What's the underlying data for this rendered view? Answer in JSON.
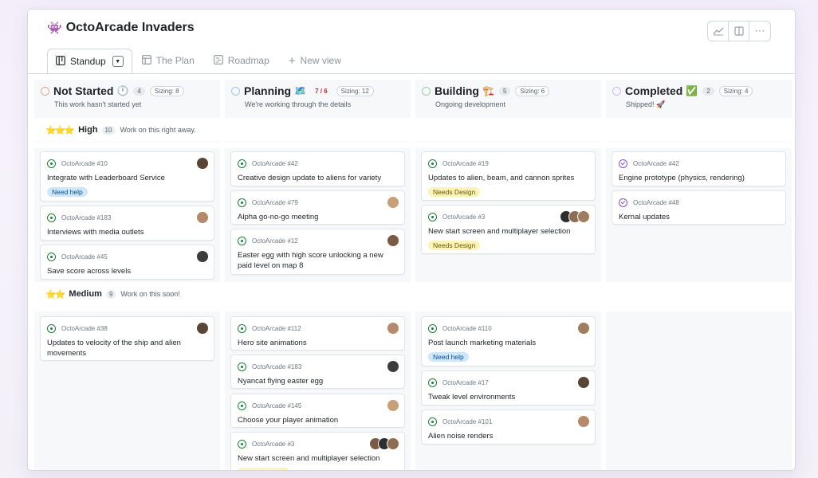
{
  "app": {
    "title": "OctoArcade Invaders",
    "title_icon": "space-invader-icon"
  },
  "top_actions": [
    "insights-icon",
    "panel-icon",
    "more-icon"
  ],
  "tabs": [
    {
      "label": "Standup",
      "active": true,
      "icon": "board-icon"
    },
    {
      "label": "The Plan",
      "active": false,
      "icon": "table-icon"
    },
    {
      "label": "Roadmap",
      "active": false,
      "icon": "roadmap-icon"
    },
    {
      "label": "New view",
      "active": false,
      "icon": "plus-icon"
    }
  ],
  "columns": [
    {
      "name": "Not Started",
      "emoji": "🕛",
      "count": "4",
      "sizing": "Sizing: 8",
      "desc": "This work hasn't started yet",
      "circle_color": "#f0a58a"
    },
    {
      "name": "Planning",
      "emoji": "🗺️",
      "count": "7 / 6",
      "sizing": "Sizing: 12",
      "desc": "We're working through the details",
      "circle_color": "#9cc7f0"
    },
    {
      "name": "Building",
      "emoji": "🏗️",
      "count": "5",
      "sizing": "Sizing: 6",
      "desc": "Ongoing development",
      "circle_color": "#92d4a0"
    },
    {
      "name": "Completed",
      "emoji": "✅",
      "count": "2",
      "sizing": "Sizing: 4",
      "desc": "Shipped! 🚀",
      "circle_color": "#d4b7f3"
    }
  ],
  "groups": [
    {
      "stars": "⭐⭐⭐",
      "name": "High",
      "count": "10",
      "desc": "Work on this right away."
    },
    {
      "stars": "⭐⭐",
      "name": "Medium",
      "count": "9",
      "desc": "Work on this soon!"
    }
  ],
  "cards": {
    "high": [
      [
        {
          "id": "OctoArcade #10",
          "title": "Integrate with Leaderboard Service",
          "label": "Need help",
          "label_type": "help"
        },
        {
          "id": "OctoArcade #183",
          "title": "Interviews with media outlets"
        },
        {
          "id": "OctoArcade #45",
          "title": "Save score across levels"
        }
      ],
      [
        {
          "id": "OctoArcade #42",
          "title": "Creative design update to aliens for variety"
        },
        {
          "id": "OctoArcade #79",
          "title": "Alpha go-no-go meeting"
        },
        {
          "id": "OctoArcade #12",
          "title": "Easter egg with high score unlocking a new paid level on map 8"
        }
      ],
      [
        {
          "id": "OctoArcade #19",
          "title": "Updates to alien, beam, and cannon sprites",
          "label": "Needs Design",
          "label_type": "design"
        },
        {
          "id": "OctoArcade #3",
          "title": "New start screen and multiplayer selection",
          "label": "Needs Design",
          "label_type": "design"
        }
      ],
      [
        {
          "id": "OctoArcade #42",
          "title": "Engine prototype (physics, rendering)"
        },
        {
          "id": "OctoArcade #48",
          "title": "Kernal updates"
        }
      ]
    ],
    "medium": [
      [
        {
          "id": "OctoArcade #38",
          "title": "Updates to velocity of the ship and alien movements"
        }
      ],
      [
        {
          "id": "OctoArcade #112",
          "title": "Hero site animations"
        },
        {
          "id": "OctoArcade #183",
          "title": "Nyancat flying easter egg"
        },
        {
          "id": "OctoArcade #145",
          "title": "Choose your player animation"
        },
        {
          "id": "OctoArcade #3",
          "title": "New start screen and multiplayer selection",
          "label": "Needs Design",
          "label_type": "design"
        }
      ],
      [
        {
          "id": "OctoArcade #110",
          "title": "Post launch marketing materials",
          "label": "Need help",
          "label_type": "help"
        },
        {
          "id": "OctoArcade #17",
          "title": "Tweak level environments"
        },
        {
          "id": "OctoArcade #101",
          "title": "Alien noise renders"
        }
      ],
      []
    ]
  },
  "colors": {
    "open_issue": "#1a7f37",
    "closed_issue": "#8250df",
    "need_help_bg": "#cfe7fa",
    "needs_design_bg": "#fbf3b8",
    "over_limit": "#cf222e"
  }
}
